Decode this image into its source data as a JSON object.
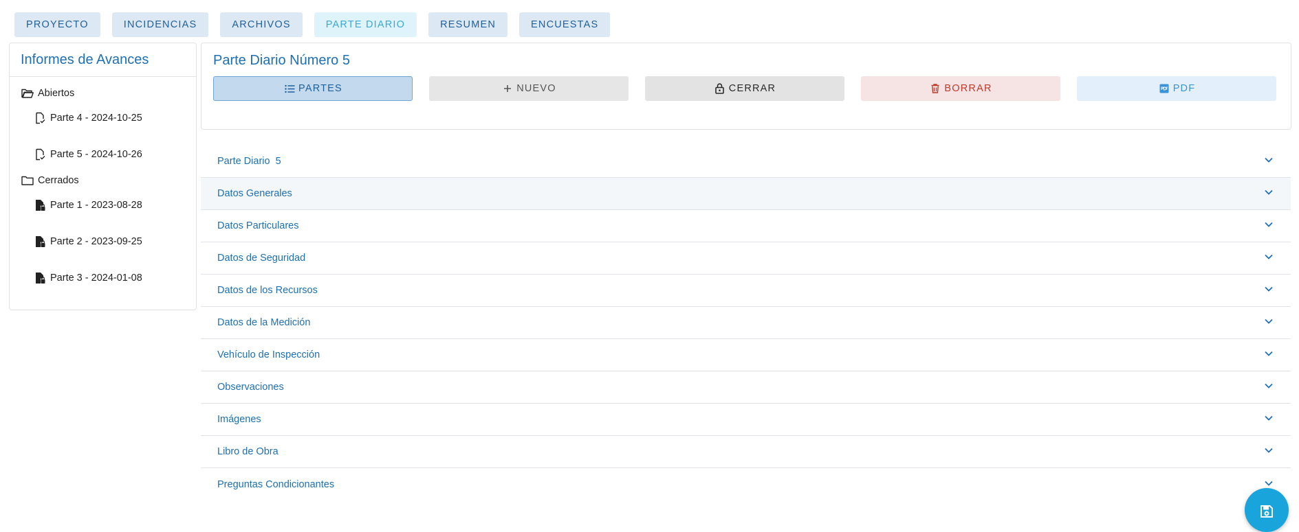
{
  "tabs": [
    "PROYECTO",
    "INCIDENCIAS",
    "ARCHIVOS",
    "PARTE DIARIO",
    "RESUMEN",
    "ENCUESTAS"
  ],
  "active_tab": "PARTE DIARIO",
  "sidebar": {
    "title": "Informes de Avances",
    "open_folder": "Abiertos",
    "open_items": [
      "Parte 4 - 2024-10-25",
      "Parte 5 - 2024-10-26"
    ],
    "closed_folder": "Cerrados",
    "closed_items": [
      "Parte 1 - 2023-08-28",
      "Parte 2 - 2023-09-25",
      "Parte 3 - 2024-01-08"
    ]
  },
  "header": {
    "title": "Parte Diario Número 5",
    "buttons": {
      "partes": "PARTES",
      "nuevo": "NUEVO",
      "cerrar": "CERRAR",
      "borrar": "BORRAR",
      "pdf": "PDF"
    }
  },
  "sections": [
    "Parte Diario  5",
    "Datos Generales",
    "Datos Particulares",
    "Datos de Seguridad",
    "Datos de los Recursos",
    "Datos de la Medición",
    "Vehículo de Inspección",
    "Observaciones",
    "Imágenes",
    "Libro de Obra",
    "Preguntas Condicionantes"
  ],
  "colors": {
    "primary": "#1e6fb3",
    "tab_bg": "#dce8f3",
    "active_tab": "#3aa8d8",
    "danger": "#c0392b",
    "fab": "#1aa4dc"
  }
}
